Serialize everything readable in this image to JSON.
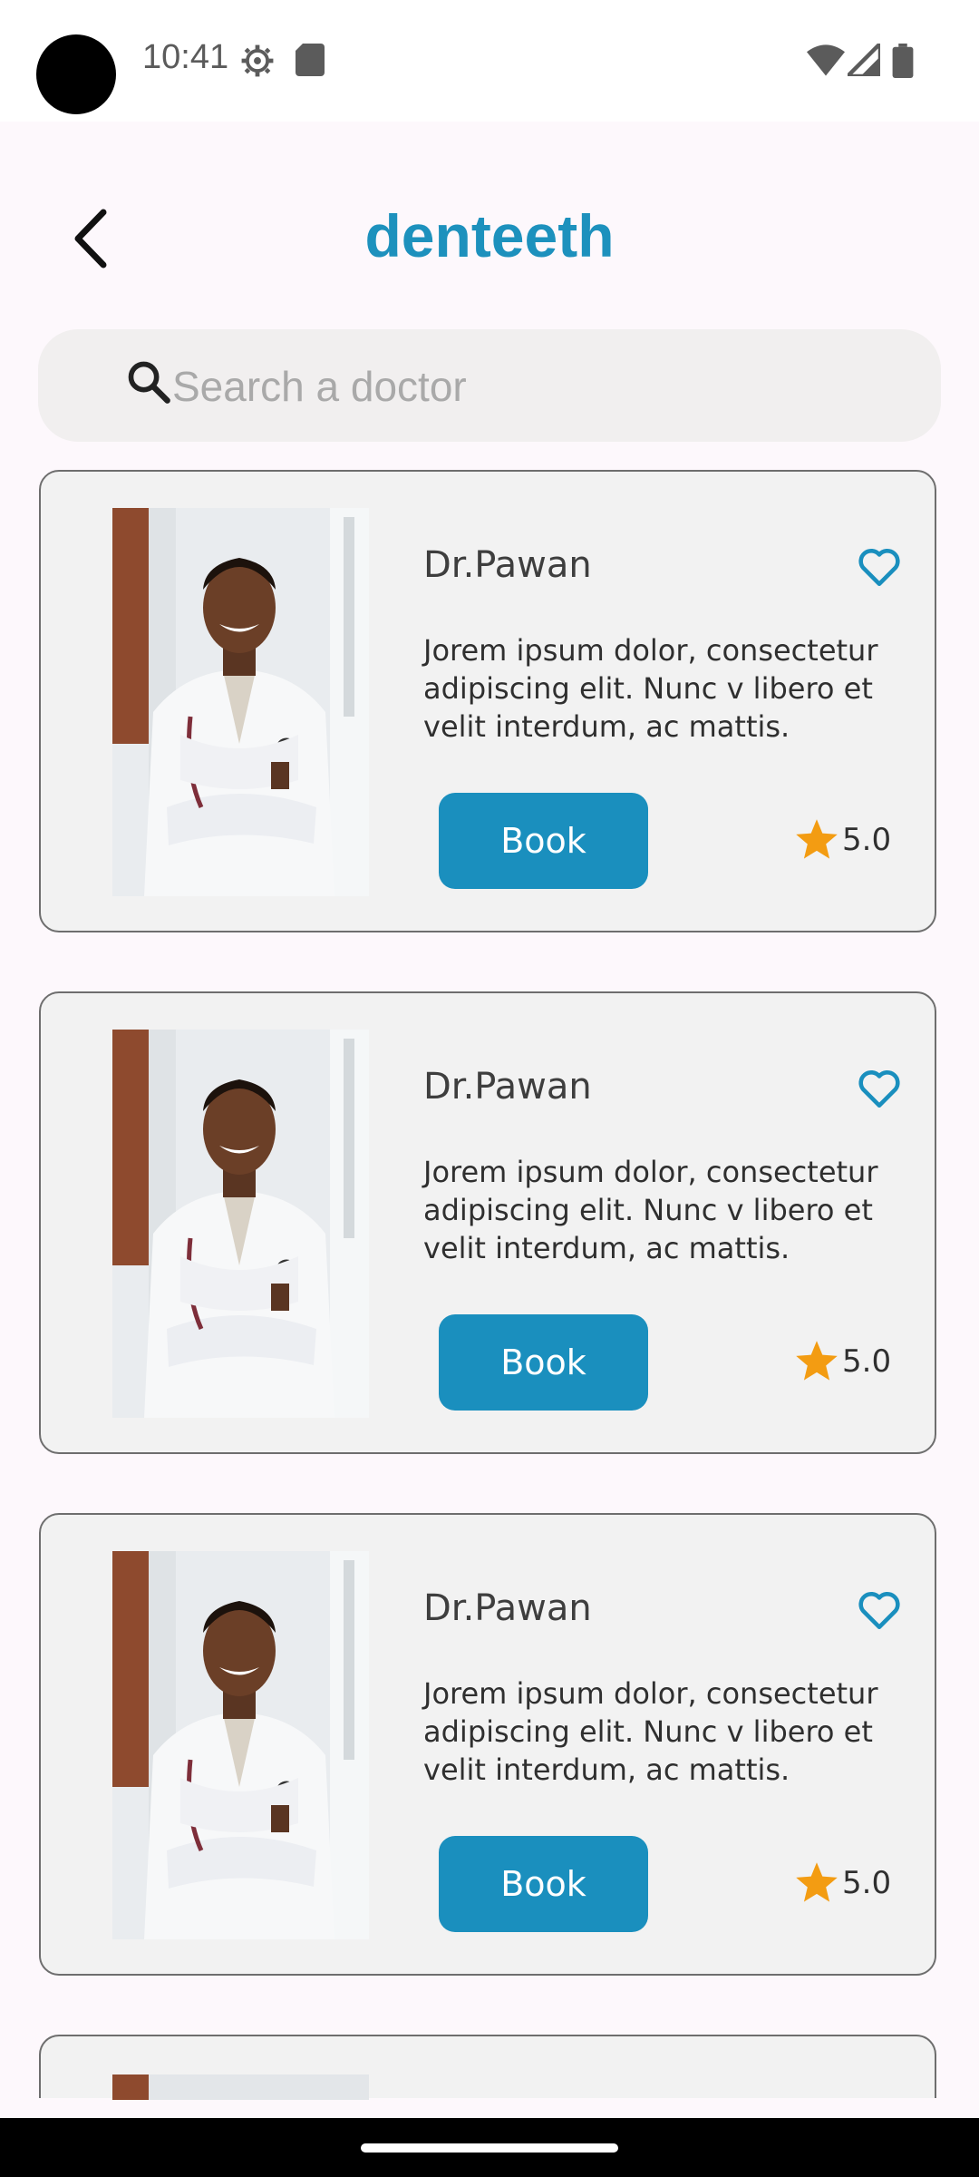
{
  "status_bar": {
    "time": "10:41",
    "icons": [
      "settings-icon",
      "sd-card-icon",
      "wifi-icon",
      "signal-icon",
      "battery-icon"
    ]
  },
  "header": {
    "title": "denteeth",
    "back_icon": "chevron-left-icon"
  },
  "search": {
    "placeholder": "Search a doctor",
    "value": ""
  },
  "doctors": [
    {
      "name": "Dr.Pawan",
      "description": "Jorem ipsum dolor, consectetur adipiscing elit. Nunc v libero et velit interdum, ac  mattis.",
      "book_label": "Book",
      "rating": "5.0"
    },
    {
      "name": "Dr.Pawan",
      "description": "Jorem ipsum dolor, consectetur adipiscing elit. Nunc v libero et velit interdum, ac  mattis.",
      "book_label": "Book",
      "rating": "5.0"
    },
    {
      "name": "Dr.Pawan",
      "description": "Jorem ipsum dolor, consectetur adipiscing elit. Nunc v libero et velit interdum, ac  mattis.",
      "book_label": "Book",
      "rating": "5.0"
    }
  ],
  "colors": {
    "accent": "#1a8fbe",
    "title": "#1d91bd",
    "star": "#f39c12",
    "card_bg": "#f2f2f2",
    "page_bg": "#fdf8fc"
  }
}
